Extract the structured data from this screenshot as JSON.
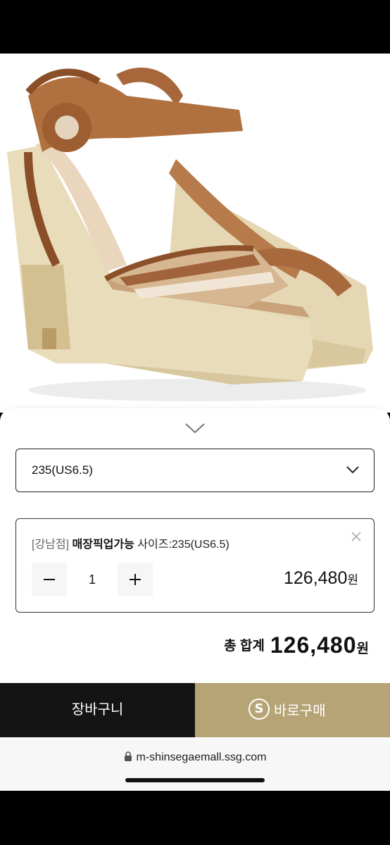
{
  "header": {
    "close_icon": "close-icon"
  },
  "product": {
    "image_desc_icon": "sandal-product-image"
  },
  "sheet": {
    "collapse_icon": "chevron-down-icon",
    "size_select": {
      "value": "235(US6.5)",
      "icon": "chevron-down-icon"
    },
    "option": {
      "store": "[강남점]",
      "pickup": "매장픽업가능",
      "size": "사이즈:235(US6.5)",
      "quantity": "1",
      "price": "126,480",
      "currency": "원"
    },
    "total": {
      "label": "총 합계",
      "price": "126,480",
      "currency": "원"
    }
  },
  "actions": {
    "cart_label": "장바구니",
    "buy_logo": "S",
    "buy_label": "바로구매",
    "cart_bg": "#141414",
    "buy_bg": "#b7a476"
  },
  "browser": {
    "url": "m-shinsegaemall.ssg.com",
    "lock_icon": "lock-icon"
  }
}
